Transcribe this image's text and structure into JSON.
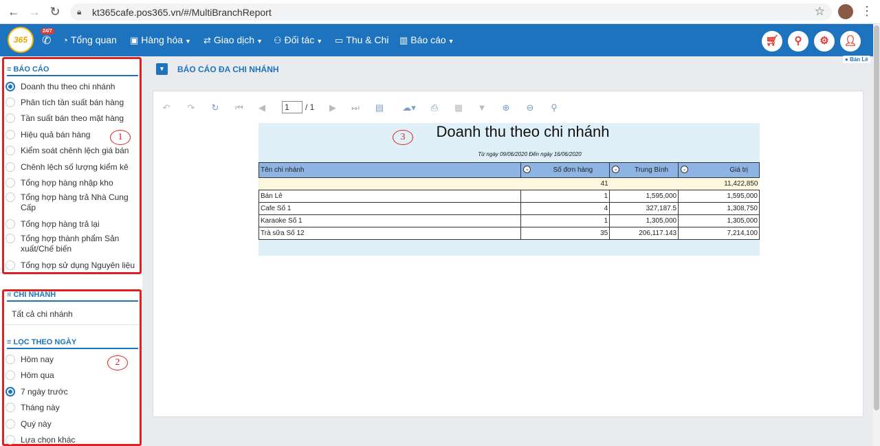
{
  "browser": {
    "url": "kt365cafe.pos365.vn/#/MultiBranchReport"
  },
  "nav": {
    "logo": "365",
    "badge": "24/7",
    "items": [
      {
        "label": "Tổng quan",
        "icon": "dashboard-icon",
        "caret": false
      },
      {
        "label": "Hàng hóa",
        "icon": "cubes-icon",
        "caret": true
      },
      {
        "label": "Giao dịch",
        "icon": "exchange-icon",
        "caret": true
      },
      {
        "label": "Đối tác",
        "icon": "users-icon",
        "caret": true
      },
      {
        "label": "Thu & Chi",
        "icon": "money-icon",
        "caret": false
      },
      {
        "label": "Báo cáo",
        "icon": "bar-chart-icon",
        "caret": true
      }
    ],
    "branch_tag": "Bán Lẻ"
  },
  "sidebar": {
    "report_header": "BÁO CÁO",
    "reports": [
      {
        "label": "Doanh thu theo chi nhánh",
        "selected": true
      },
      {
        "label": "Phân tích tần suất bán hàng",
        "selected": false
      },
      {
        "label": "Tần suất bán theo mặt hàng",
        "selected": false
      },
      {
        "label": "Hiệu quả bán hàng",
        "selected": false
      },
      {
        "label": "Kiểm soát chênh lệch giá bán",
        "selected": false
      },
      {
        "label": "Chênh lệch số lượng kiểm kê",
        "selected": false
      },
      {
        "label": "Tổng hợp hàng nhập kho",
        "selected": false
      },
      {
        "label": "Tổng hợp hàng trả Nhà Cung Cấp",
        "selected": false
      },
      {
        "label": "Tổng hợp hàng trả lại",
        "selected": false
      },
      {
        "label": "Tổng hợp thành phẩm Sản xuất/Chế biến",
        "selected": false
      },
      {
        "label": "Tổng hợp sử dụng Nguyên liệu",
        "selected": false
      }
    ],
    "branch_header": "CHI NHÁNH",
    "branch_value": "Tất cả chi nhánh",
    "date_header": "LỌC THEO NGÀY",
    "dates": [
      {
        "label": "Hôm nay",
        "selected": false
      },
      {
        "label": "Hôm qua",
        "selected": false
      },
      {
        "label": "7 ngày trước",
        "selected": true
      },
      {
        "label": "Tháng này",
        "selected": false
      },
      {
        "label": "Quý này",
        "selected": false
      },
      {
        "label": "Lựa chọn khác",
        "selected": false
      }
    ],
    "annotation_1": "1",
    "annotation_2": "2"
  },
  "main": {
    "title": "BÁO CÁO ĐA CHI NHÁNH",
    "page_current": "1",
    "page_total": "/ 1",
    "annotation_3": "3",
    "report": {
      "title": "Doanh thu theo chi nhánh",
      "date_range": "Từ ngày 09/06/2020 Đến ngày 16/06/2020",
      "columns": [
        "Tên chi nhánh",
        "Số đơn hàng",
        "Trung Bình",
        "Giá trị"
      ],
      "total_row": [
        "",
        "41",
        "",
        "11,422,850"
      ],
      "rows": [
        [
          "Bán Lẻ",
          "1",
          "1,595,000",
          "1,595,000"
        ],
        [
          "Cafe Số 1",
          "4",
          "327,187.5",
          "1,308,750"
        ],
        [
          "Karaoke Số 1",
          "1",
          "1,305,000",
          "1,305,000"
        ],
        [
          "Trà sữa Số 12",
          "35",
          "206,117.143",
          "7,214,100"
        ]
      ]
    }
  }
}
